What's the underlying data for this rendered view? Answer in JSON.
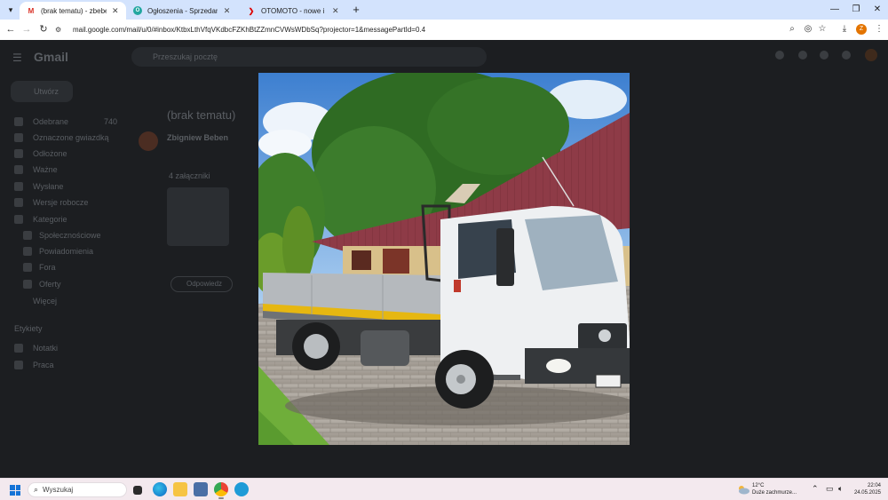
{
  "browser": {
    "tabs": [
      {
        "title": "(brak tematu) - zbeben@gmail.",
        "favicon": "M",
        "active": true
      },
      {
        "title": "Ogłoszenia - Sprzedam, kupię o",
        "favicon": "O",
        "active": false
      },
      {
        "title": "OTOMOTO - nowe i używane sa",
        "favicon": "❯",
        "active": false
      }
    ],
    "close_glyph": "✕",
    "new_tab_glyph": "+",
    "url": "mail.google.com/mail/u/0/#inbox/KtbxLthVfqVKdbcFZKhBtZZmnCVWsWDbSq?projector=1&messagePartId=0.4",
    "profile_initial": "Z"
  },
  "gmail": {
    "logo": "Gmail",
    "search_placeholder": "Przeszukaj pocztę",
    "compose": "Utwórz",
    "nav": [
      {
        "label": "Odebrane",
        "count": "740"
      },
      {
        "label": "Oznaczone gwiazdką",
        "count": ""
      },
      {
        "label": "Odłożone",
        "count": ""
      },
      {
        "label": "Ważne",
        "count": ""
      },
      {
        "label": "Wysłane",
        "count": ""
      },
      {
        "label": "Wersje robocze",
        "count": ""
      },
      {
        "label": "Kategorie",
        "count": ""
      },
      {
        "label": "Społecznościowe",
        "count": ""
      },
      {
        "label": "Powiadomienia",
        "count": ""
      },
      {
        "label": "Fora",
        "count": ""
      },
      {
        "label": "Oferty",
        "count": ""
      },
      {
        "label": "Więcej",
        "count": ""
      }
    ],
    "labels_header": "Etykiety",
    "labels": [
      "Notatki",
      "Praca"
    ],
    "subject": "(brak tematu)",
    "sender": "Zbigniew Beben",
    "attachments_header": "4 załączniki",
    "reply_button": "Odpowiedz"
  },
  "taskbar": {
    "search_placeholder": "Wyszukaj",
    "weather_temp": "12°C",
    "weather_desc": "Duże zachmurze...",
    "time": "22:04",
    "date": "24.05.2025"
  },
  "colors": {
    "tab_strip": "#d3e3fd",
    "viewer_backdrop": "#1f1f1f",
    "truck_cab": "#eef0f2",
    "roof": "#8e3b47",
    "taskbar": "#f3e9ee"
  }
}
